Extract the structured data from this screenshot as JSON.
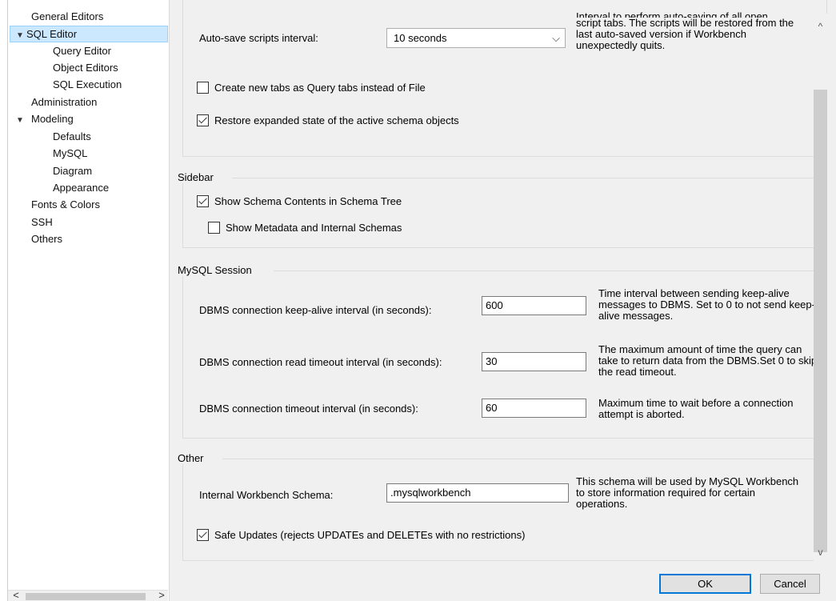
{
  "tree": {
    "items": [
      {
        "label": "General Editors",
        "arrow": ""
      },
      {
        "label": "SQL Editor",
        "arrow": "▼"
      },
      {
        "label": "Query Editor",
        "arrow": ""
      },
      {
        "label": "Object Editors",
        "arrow": ""
      },
      {
        "label": "SQL Execution",
        "arrow": ""
      },
      {
        "label": "Administration",
        "arrow": ""
      },
      {
        "label": "Modeling",
        "arrow": "▼"
      },
      {
        "label": "Defaults",
        "arrow": ""
      },
      {
        "label": "MySQL",
        "arrow": ""
      },
      {
        "label": "Diagram",
        "arrow": ""
      },
      {
        "label": "Appearance",
        "arrow": ""
      },
      {
        "label": "Fonts & Colors",
        "arrow": ""
      },
      {
        "label": "SSH",
        "arrow": ""
      },
      {
        "label": "Others",
        "arrow": ""
      }
    ],
    "scroll_left": "<",
    "scroll_right": ">"
  },
  "editor": {
    "autosave_label": "Auto-save scripts interval:",
    "autosave_value": "10 seconds",
    "autosave_desc_top": "Interval to perform auto-saving of all open",
    "autosave_desc": "script tabs. The scripts will be restored from the last auto-saved version if Workbench unexpectedly quits.",
    "query_tabs_label": "Create new tabs as Query tabs instead of File",
    "query_tabs_checked": false,
    "restore_label": "Restore expanded state of the active schema objects",
    "restore_checked": true
  },
  "sidebar": {
    "title": "Sidebar",
    "schema_contents_label": "Show Schema Contents in Schema Tree",
    "schema_contents_checked": true,
    "metadata_label": "Show Metadata and Internal Schemas",
    "metadata_checked": false
  },
  "session": {
    "title": "MySQL Session",
    "keepalive_label": "DBMS connection keep-alive interval (in seconds):",
    "keepalive_value": "600",
    "keepalive_desc": "Time interval between sending keep-alive messages to DBMS. Set to 0 to not send keep-alive messages.",
    "read_timeout_label": "DBMS connection read timeout interval (in seconds):",
    "read_timeout_value": "30",
    "read_timeout_desc": "The maximum amount of time the query can take to return data from the DBMS.Set 0 to skip the read timeout.",
    "conn_timeout_label": "DBMS connection timeout interval (in seconds):",
    "conn_timeout_value": "60",
    "conn_timeout_desc": "Maximum time to wait before a connection attempt is aborted."
  },
  "other": {
    "title": "Other",
    "schema_label": "Internal Workbench Schema:",
    "schema_value": ".mysqlworkbench",
    "schema_desc": "This schema will be used by MySQL Workbench to store information required for certain operations.",
    "safe_updates_label": "Safe Updates (rejects UPDATEs and DELETEs with no restrictions)",
    "safe_updates_checked": true
  },
  "footer": {
    "ok_label": "OK",
    "cancel_label": "Cancel"
  },
  "icons": {
    "chevron_down": "⌵",
    "scroll_up": "^",
    "scroll_down": "v"
  },
  "colors": {
    "selection_bg": "#cce8ff",
    "selection_border": "#99d1ff",
    "panel_bg": "#f0f0f0",
    "default_button_border": "#0078d7"
  }
}
